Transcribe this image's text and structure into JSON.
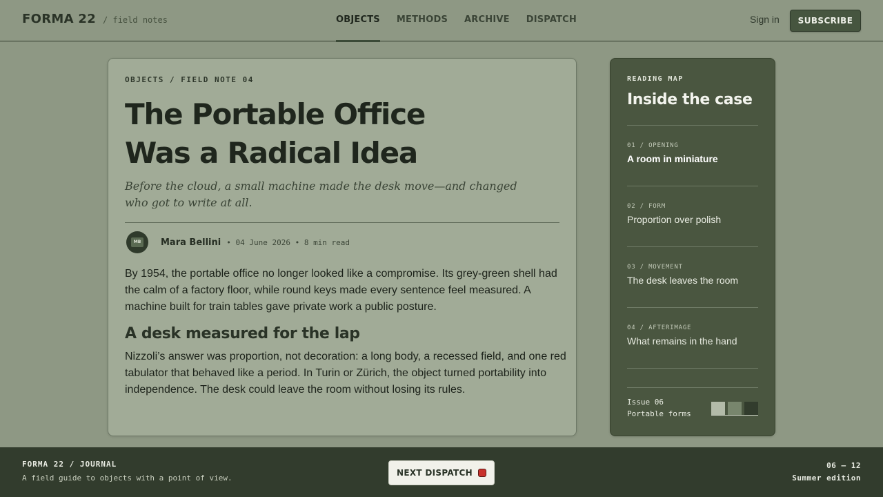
{
  "header": {
    "brand": "FORMA 22",
    "tagline": "/ field notes",
    "nav": [
      "OBJECTS",
      "METHODS",
      "ARCHIVE",
      "DISPATCH"
    ],
    "active_nav": "OBJECTS",
    "signin": "Sign in",
    "subscribe": "SUBSCRIBE"
  },
  "article": {
    "kicker": "OBJECTS / FIELD NOTE 04",
    "title_lines": [
      "The Portable Office",
      "Was a Radical Idea"
    ],
    "dek": "Before the cloud, a small machine made the desk move—and changed who got to write at all.",
    "avatar_initials": "MB",
    "author": "Mara Bellini",
    "meta": "• 04 June 2026 • 8 min read",
    "paragraph1": "By 1954, the portable office no longer looked like a compromise. Its grey-green shell had the calm of a factory floor, while round keys made every sentence feel measured. A machine built for train tables gave private work a public posture.",
    "subheading": "A desk measured for the lap",
    "paragraph2": "Nizzoli’s answer was proportion, not decoration: a long body, a recessed field, and one red tabulator that behaved like a period. In Turin or Zürich, the object turned portability into independence. The desk could leave the room without losing its rules."
  },
  "sidebar": {
    "kicker": "READING MAP",
    "title": "Inside the case",
    "items": [
      {
        "num": "01 / OPENING",
        "label": "A room in miniature",
        "active": true
      },
      {
        "num": "02 / FORM",
        "label": "Proportion over polish",
        "active": false
      },
      {
        "num": "03 / MOVEMENT",
        "label": "The desk leaves the room",
        "active": false
      },
      {
        "num": "04 / AFTERIMAGE",
        "label": "What remains in the hand",
        "active": false
      }
    ],
    "issue_line1": "Issue 06",
    "issue_line2": "Portable forms",
    "swatches": [
      "#b3bba9",
      "#78866d",
      "#323c2d"
    ]
  },
  "footer": {
    "brand": "FORMA 22 / JOURNAL",
    "tagline": "A field guide to objects with a point of view.",
    "next_button": "NEXT DISPATCH",
    "range": "06 — 12",
    "edition": "Summer edition"
  },
  "colors": {
    "background": "#8e9884",
    "card": "#a1ab97",
    "sidebar": "#4a5640",
    "footer": "#323c2d",
    "accent_red": "#c8312b"
  }
}
